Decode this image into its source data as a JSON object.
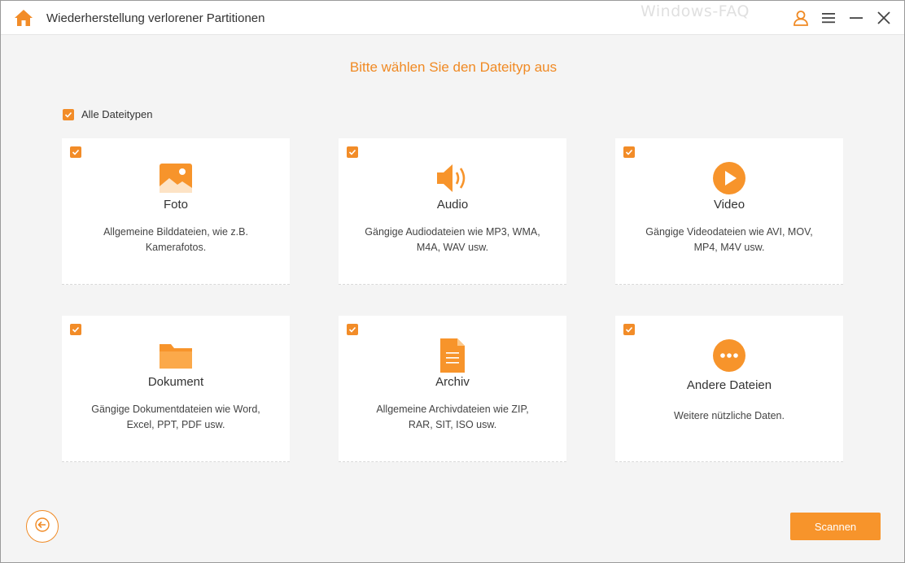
{
  "titlebar": {
    "title": "Wiederherstellung verlorener Partitionen",
    "watermark": "Windows-FAQ",
    "icons": [
      "home-icon",
      "user-icon",
      "menu-icon",
      "minimize-icon",
      "close-icon"
    ]
  },
  "main": {
    "heading": "Bitte wählen Sie den Dateityp aus",
    "all_types": {
      "label": "Alle Dateitypen",
      "checked": true
    },
    "cards": [
      {
        "name": "Foto",
        "desc": "Allgemeine Bilddateien, wie z.B. Kamerafotos.",
        "icon": "photo-icon",
        "checked": true
      },
      {
        "name": "Audio",
        "desc": "Gängige Audiodateien wie MP3, WMA, M4A, WAV usw.",
        "icon": "speaker-icon",
        "checked": true
      },
      {
        "name": "Video",
        "desc": "Gängige Videodateien wie AVI, MOV, MP4, M4V usw.",
        "icon": "play-icon",
        "checked": true
      },
      {
        "name": "Dokument",
        "desc": "Gängige Dokumentdateien wie Word, Excel, PPT, PDF usw.",
        "icon": "folder-icon",
        "checked": true
      },
      {
        "name": "Archiv",
        "desc": "Allgemeine Archivdateien wie ZIP, RAR, SIT, ISO usw.",
        "icon": "archive-file-icon",
        "checked": true
      },
      {
        "name": "Andere Dateien",
        "desc": "Weitere nützliche Daten.",
        "icon": "more-icon",
        "checked": true
      }
    ]
  },
  "footer": {
    "back_icon": "arrow-left-icon",
    "scan_label": "Scannen"
  },
  "colors": {
    "accent": "#f28c28",
    "heading": "#f08a24",
    "background": "#f4f4f4",
    "card": "#ffffff"
  }
}
